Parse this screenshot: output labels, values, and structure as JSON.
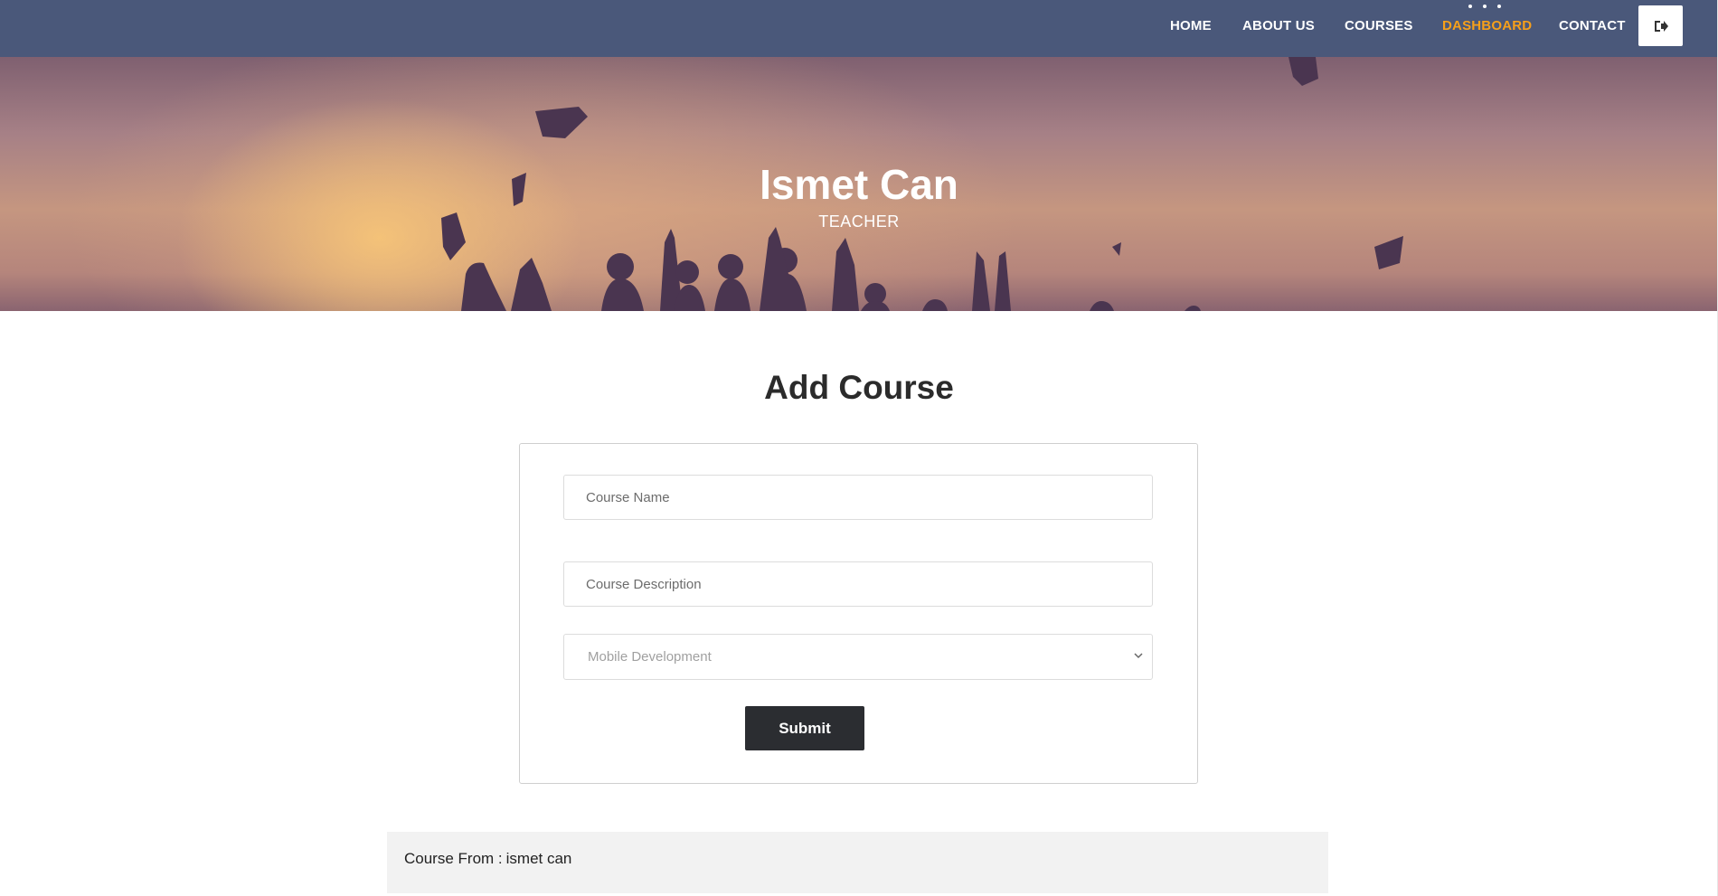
{
  "nav": {
    "items": [
      {
        "label": "HOME",
        "active": false
      },
      {
        "label": "ABOUT US",
        "active": false
      },
      {
        "label": "COURSES",
        "active": false
      },
      {
        "label": "DASHBOARD",
        "active": true
      },
      {
        "label": "CONTACT",
        "active": false
      }
    ],
    "logout_icon": "sign-out-icon",
    "bg_color": "#4a587a",
    "active_color": "#f6a01a"
  },
  "hero": {
    "name": "Ismet Can",
    "role": "TEACHER"
  },
  "form": {
    "heading": "Add Course",
    "course_name": {
      "placeholder": "Course Name",
      "value": ""
    },
    "course_description": {
      "placeholder": "Course Description",
      "value": ""
    },
    "category": {
      "selected": "Mobile Development"
    },
    "submit_label": "Submit"
  },
  "courses": {
    "from_label": "Course From :",
    "owner": "ismet can"
  }
}
